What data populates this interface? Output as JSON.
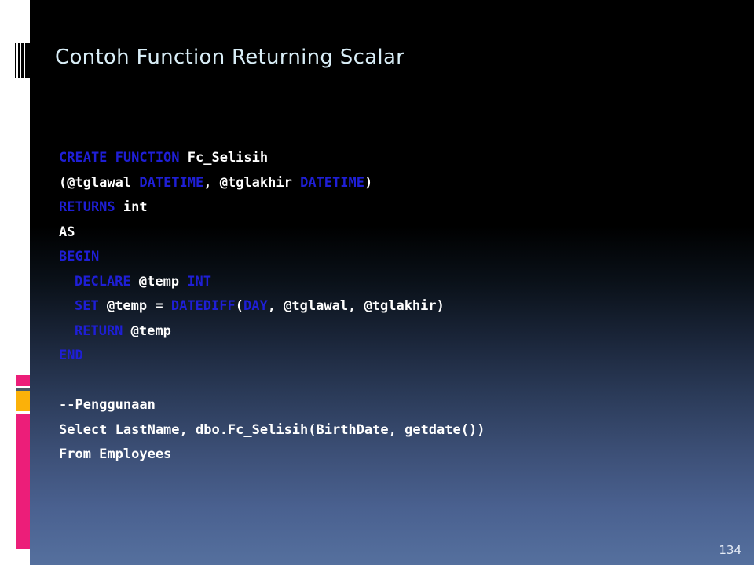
{
  "slide": {
    "title": "Contoh Function Returning Scalar",
    "page_number": "134",
    "colors": {
      "title_text": "#d9eef7",
      "keyword_blue": "#1f1fd6",
      "body_white": "#ffffff",
      "accent_pink": "#ec1e79",
      "accent_gray": "#4d5a67",
      "accent_amber": "#fbb109",
      "background_top": "#000000",
      "background_bottom": "#55709e",
      "margin_white": "#ffffff"
    }
  },
  "code": {
    "lines": [
      {
        "id": "line-1",
        "indent": 0,
        "tokens": [
          {
            "t": "CREATE FUNCTION ",
            "c": "kw"
          },
          {
            "t": "Fc_Selisih",
            "c": "pl"
          }
        ]
      },
      {
        "id": "line-2",
        "indent": 0,
        "tokens": [
          {
            "t": "(@tglawal ",
            "c": "pl"
          },
          {
            "t": "DATETIME",
            "c": "kw"
          },
          {
            "t": ", @tglakhir ",
            "c": "pl"
          },
          {
            "t": "DATETIME",
            "c": "kw"
          },
          {
            "t": ")",
            "c": "pl"
          }
        ]
      },
      {
        "id": "line-3",
        "indent": 0,
        "tokens": [
          {
            "t": "RETURNS ",
            "c": "kw"
          },
          {
            "t": "int",
            "c": "pl"
          }
        ]
      },
      {
        "id": "line-4",
        "indent": 0,
        "tokens": [
          {
            "t": "AS",
            "c": "pl"
          }
        ]
      },
      {
        "id": "line-5",
        "indent": 0,
        "tokens": [
          {
            "t": "BEGIN",
            "c": "kw"
          }
        ]
      },
      {
        "id": "line-6",
        "indent": 2,
        "tokens": [
          {
            "t": "DECLARE ",
            "c": "kw"
          },
          {
            "t": "@temp ",
            "c": "pl"
          },
          {
            "t": "INT",
            "c": "kw"
          }
        ]
      },
      {
        "id": "line-7",
        "indent": 2,
        "tokens": [
          {
            "t": "SET ",
            "c": "kw"
          },
          {
            "t": "@temp = ",
            "c": "pl"
          },
          {
            "t": "DATEDIFF",
            "c": "kw"
          },
          {
            "t": "(",
            "c": "pl"
          },
          {
            "t": "DAY",
            "c": "kw"
          },
          {
            "t": ", @tglawal, @tglakhir)",
            "c": "pl"
          }
        ]
      },
      {
        "id": "line-8",
        "indent": 2,
        "tokens": [
          {
            "t": "RETURN ",
            "c": "kw"
          },
          {
            "t": "@temp",
            "c": "pl"
          }
        ]
      },
      {
        "id": "line-9",
        "indent": 0,
        "tokens": [
          {
            "t": "END",
            "c": "kw"
          }
        ]
      },
      {
        "id": "line-10",
        "indent": 0,
        "blank": true,
        "tokens": []
      },
      {
        "id": "line-11",
        "indent": 0,
        "tokens": [
          {
            "t": "--Penggunaan",
            "c": "pl"
          }
        ]
      },
      {
        "id": "line-12",
        "indent": 0,
        "wrap": true,
        "tokens": [
          {
            "t": "Select LastName, dbo.Fc_Selisih(BirthDate, getdate())",
            "c": "pl"
          }
        ]
      },
      {
        "id": "line-13",
        "indent": 0,
        "tokens": [
          {
            "t": "From Employees",
            "c": "pl"
          }
        ]
      }
    ]
  }
}
